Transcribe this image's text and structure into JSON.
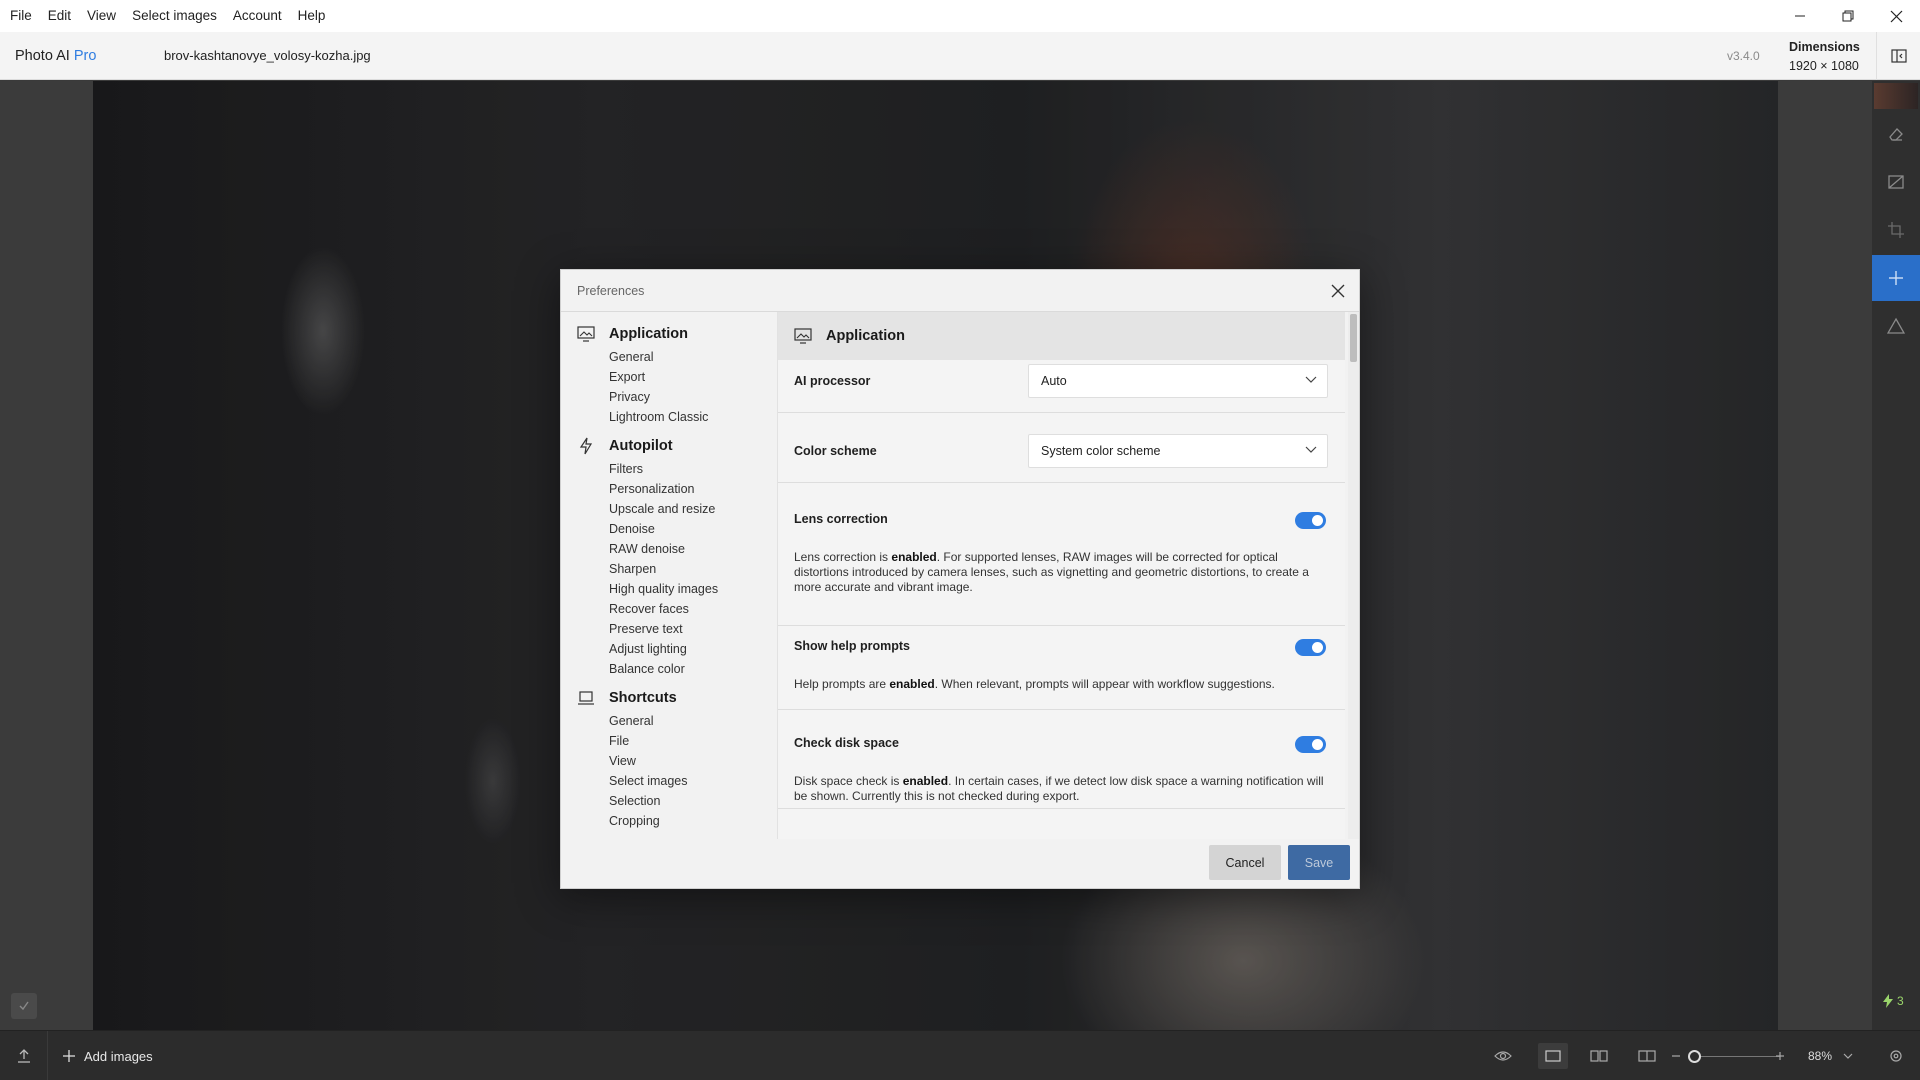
{
  "menubar": {
    "items": [
      "File",
      "Edit",
      "View",
      "Select images",
      "Account",
      "Help"
    ]
  },
  "header": {
    "app_name": "Photo AI",
    "app_tier": "Pro",
    "file_name": "brov-kashtanovye_volosy-kozha.jpg",
    "version": "v3.4.0",
    "dimensions_label": "Dimensions",
    "dimensions_value": "1920 × 1080"
  },
  "bottombar": {
    "add_images_label": "Add images",
    "zoom_value": "88%"
  },
  "right_rail": {
    "credits": "3"
  },
  "dialog": {
    "title": "Preferences",
    "nav": {
      "application": {
        "label": "Application",
        "items": [
          "General",
          "Export",
          "Privacy",
          "Lightroom Classic"
        ]
      },
      "autopilot": {
        "label": "Autopilot",
        "items": [
          "Filters",
          "Personalization",
          "Upscale and resize",
          "Denoise",
          "RAW denoise",
          "Sharpen",
          "High quality images",
          "Recover faces",
          "Preserve text",
          "Adjust lighting",
          "Balance color"
        ]
      },
      "shortcuts": {
        "label": "Shortcuts",
        "items": [
          "General",
          "File",
          "View",
          "Select images",
          "Selection",
          "Cropping"
        ]
      }
    },
    "content": {
      "header": "Application",
      "ai_processor": {
        "label": "AI processor",
        "value": "Auto"
      },
      "color_scheme": {
        "label": "Color scheme",
        "value": "System color scheme"
      },
      "lens_correction": {
        "label": "Lens correction",
        "enabled": true,
        "desc_pre": "Lens correction is ",
        "desc_bold": "enabled",
        "desc_post": ". For supported lenses, RAW images will be corrected for optical distortions introduced by camera lenses, such as vignetting and geometric distortions, to create a more accurate and vibrant image."
      },
      "help_prompts": {
        "label": "Show help prompts",
        "enabled": true,
        "desc_pre": "Help prompts are ",
        "desc_bold": "enabled",
        "desc_post": ". When relevant, prompts will appear with workflow suggestions."
      },
      "disk_space": {
        "label": "Check disk space",
        "enabled": true,
        "desc_pre": "Disk space check is ",
        "desc_bold": "enabled",
        "desc_post": ". In certain cases, if we detect low disk space a warning notification will be shown. Currently this is not checked during export."
      }
    },
    "cancel_label": "Cancel",
    "save_label": "Save"
  },
  "colors": {
    "accent": "#2f7de1",
    "save_button": "#3e6aa3",
    "credits": "#9ad56b"
  }
}
